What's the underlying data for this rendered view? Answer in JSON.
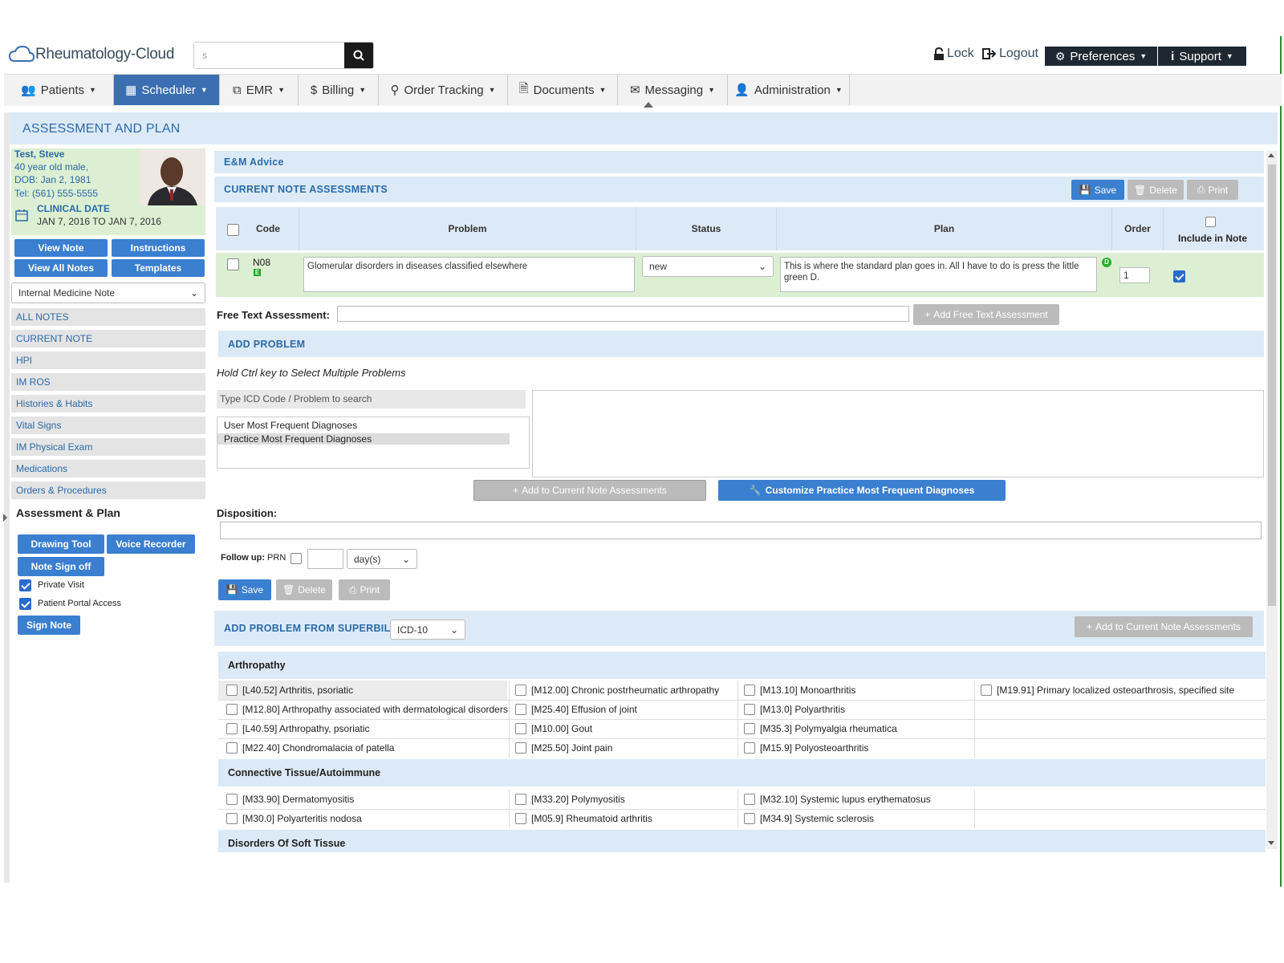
{
  "header": {
    "logo_text": "Rheumatology-Cloud",
    "search_value": "s",
    "lock": "Lock",
    "logout": "Logout",
    "preferences": "Preferences",
    "support": "Support"
  },
  "nav": [
    {
      "label": "Patients",
      "icon": "users-icon"
    },
    {
      "label": "Scheduler",
      "icon": "calendar-icon",
      "active": true
    },
    {
      "label": "EMR",
      "icon": "copy-icon"
    },
    {
      "label": "Billing",
      "icon": "dollar-icon"
    },
    {
      "label": "Order Tracking",
      "icon": "search-icon"
    },
    {
      "label": "Documents",
      "icon": "document-icon"
    },
    {
      "label": "Messaging",
      "icon": "envelope-icon"
    },
    {
      "label": "Administration",
      "icon": "user-icon"
    }
  ],
  "page_title": "ASSESSMENT AND PLAN",
  "patient": {
    "name": "Test, Steve",
    "age_sex": "40 year old male,",
    "dob": "DOB: Jan 2, 1981",
    "tel": "Tel: (561) 555-5555",
    "clinical_date_label": "CLINICAL DATE",
    "clinical_date_range": "JAN 7, 2016 TO JAN 7, 2016"
  },
  "left_buttons": {
    "view_note": "View Note",
    "instructions": "Instructions",
    "view_all_notes": "View All Notes",
    "templates": "Templates"
  },
  "note_type": "Internal Medicine Note",
  "sidenav": [
    "ALL NOTES",
    "CURRENT NOTE",
    "HPI",
    "IM ROS",
    "Histories & Habits",
    "Vital Signs",
    "IM Physical Exam",
    "Medications",
    "Orders & Procedures"
  ],
  "sidenav_active": "Assessment & Plan",
  "tools": {
    "drawing_tool": "Drawing Tool",
    "voice_recorder": "Voice Recorder",
    "note_sign_off": "Note Sign off",
    "private_visit": "Private Visit",
    "patient_portal": "Patient Portal Access",
    "sign_note": "Sign Note"
  },
  "em_advice": "E&M Advice",
  "current_assessments": {
    "title": "CURRENT NOTE ASSESSMENTS",
    "save": "Save",
    "delete": "Delete",
    "print": "Print",
    "columns": {
      "code": "Code",
      "problem": "Problem",
      "status": "Status",
      "plan": "Plan",
      "order": "Order",
      "include": "Include in Note"
    },
    "row": {
      "code": "N08",
      "code_badge": "E",
      "problem": "Glomerular disorders in diseases classified elsewhere",
      "status": "new",
      "plan": "This is where the standard plan goes in. All I have to do is press the little green D.",
      "plan_badge": "D",
      "order": "1"
    }
  },
  "free_text": {
    "label": "Free Text Assessment:",
    "button": "Add Free Text Assessment"
  },
  "add_problem": {
    "title": "ADD PROBLEM",
    "hint": "Hold Ctrl key to Select Multiple Problems",
    "search_placeholder": "Type ICD Code / Problem to search",
    "list": [
      "User Most Frequent Diagnoses",
      "Practice Most Frequent Diagnoses"
    ],
    "add_button": "Add to Current Note Assessments",
    "customize_button": "Customize Practice Most Frequent Diagnoses"
  },
  "disposition_label": "Disposition:",
  "followup": {
    "label": "Follow up:",
    "prn": "PRN",
    "unit": "day(s)"
  },
  "bottom_buttons": {
    "save": "Save",
    "delete": "Delete",
    "print": "Print"
  },
  "superbill": {
    "title": "ADD PROBLEM FROM SUPERBILL",
    "code_set": "ICD-10",
    "add_button": "Add to Current Note Assessments",
    "groups": [
      {
        "name": "Arthropathy",
        "rows": [
          [
            "[L40.52] Arthritis, psoriatic",
            "[M12.00] Chronic postrheumatic arthropathy",
            "[M13.10] Monoarthritis",
            "[M19.91] Primary localized osteoarthrosis, specified site"
          ],
          [
            "[M12.80] Arthropathy associated with dermatological disorders",
            "[M25.40] Effusion of joint",
            "[M13.0] Polyarthritis",
            ""
          ],
          [
            "[L40.59] Arthropathy, psoriatic",
            "[M10.00] Gout",
            "[M35.3] Polymyalgia rheumatica",
            ""
          ],
          [
            "[M22.40] Chondromalacia of patella",
            "[M25.50] Joint pain",
            "[M15.9] Polyosteoarthritis",
            ""
          ]
        ]
      },
      {
        "name": "Connective Tissue/Autoimmune",
        "rows": [
          [
            "[M33.90] Dermatomyositis",
            "[M33.20] Polymyositis",
            "[M32.10] Systemic lupus erythematosus",
            ""
          ],
          [
            "[M30.0] Polyarteritis nodosa",
            "[M05.9] Rheumatoid arthritis",
            "[M34.9] Systemic sclerosis",
            ""
          ]
        ]
      },
      {
        "name": "Disorders Of Soft Tissue",
        "rows": []
      }
    ]
  },
  "colors": {
    "primary": "#3a7fd0",
    "nav_active": "#3c6fb1",
    "section_bg": "#dceaf7",
    "patient_bg": "#dcefd3",
    "dark": "#1e2833"
  }
}
